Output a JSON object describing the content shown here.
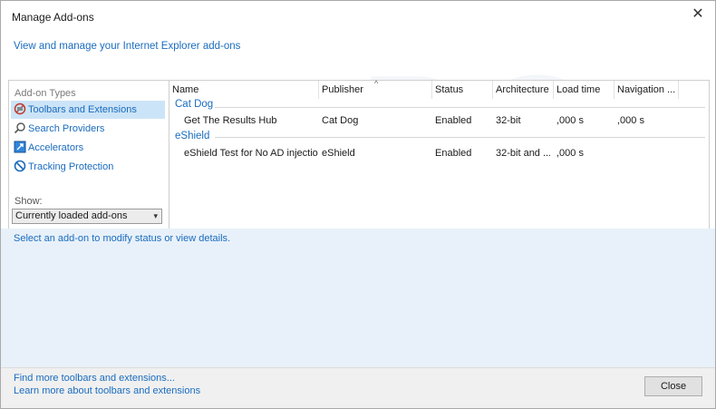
{
  "window": {
    "title": "Manage Add-ons",
    "top_link": "View and manage your Internet Explorer add-ons"
  },
  "sidebar": {
    "heading": "Add-on Types",
    "items": [
      {
        "label": "Toolbars and Extensions",
        "icon": "toolbars-extensions-icon",
        "selected": true
      },
      {
        "label": "Search Providers",
        "icon": "search-icon",
        "selected": false
      },
      {
        "label": "Accelerators",
        "icon": "accelerators-icon",
        "selected": false
      },
      {
        "label": "Tracking Protection",
        "icon": "tracking-protection-icon",
        "selected": false
      }
    ],
    "show_label": "Show:",
    "show_value": "Currently loaded add-ons"
  },
  "list": {
    "columns": [
      "Name",
      "Publisher",
      "Status",
      "Architecture",
      "Load time",
      "Navigation ..."
    ],
    "groups": [
      {
        "name": "Cat Dog",
        "rows": [
          {
            "name": "Get The Results Hub",
            "publisher": "Cat Dog",
            "status": "Enabled",
            "architecture": "32-bit",
            "load_time": ",000 s",
            "navigation": ",000 s"
          }
        ]
      },
      {
        "name": "eShield",
        "rows": [
          {
            "name": "eShield Test for No AD injection",
            "publisher": "eShield",
            "status": "Enabled",
            "architecture": "32-bit and ...",
            "load_time": ",000 s",
            "navigation": ""
          }
        ]
      }
    ]
  },
  "status_text": "Select an add-on to modify status or view details.",
  "footer": {
    "link1": "Find more toolbars and extensions...",
    "link2": "Learn more about toolbars and extensions",
    "close_label": "Close"
  },
  "colors": {
    "link": "#1a6cbf",
    "selected_bg": "#cce4f7",
    "details_bg": "#e8f1f9"
  }
}
